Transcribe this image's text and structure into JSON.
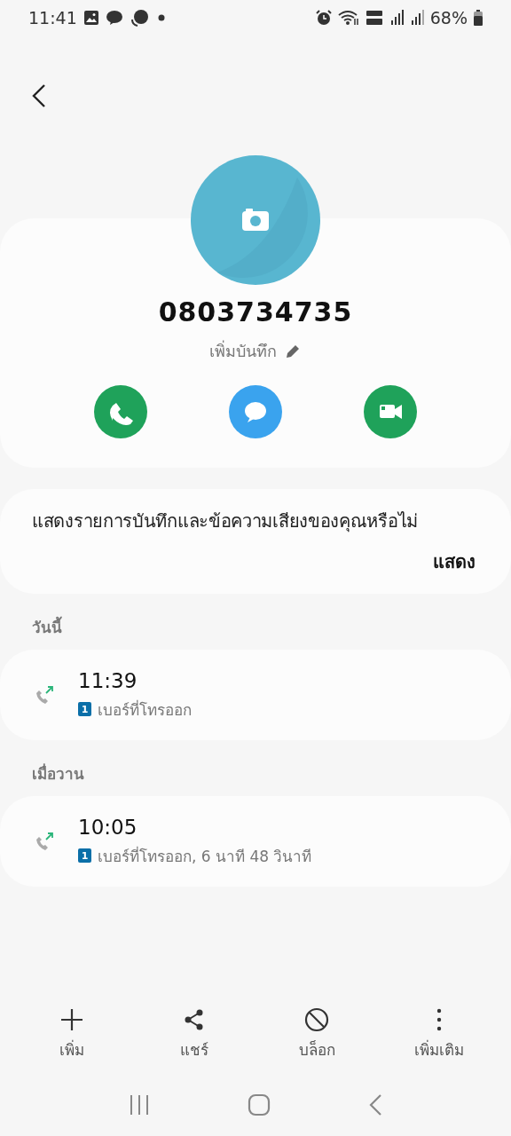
{
  "status_bar": {
    "time": "11:41",
    "battery": "68%"
  },
  "contact": {
    "number": "0803734735",
    "note_link": "เพิ่มบันทึก",
    "actions": [
      {
        "kind": "call"
      },
      {
        "kind": "message"
      },
      {
        "kind": "video"
      }
    ]
  },
  "notice": {
    "text": "แสดงรายการบันทึกและข้อความเสียงของคุณหรือไม่",
    "button": "แสดง"
  },
  "call_groups": [
    {
      "heading": "วันนี้",
      "calls": [
        {
          "kind": "outgoing",
          "time": "11:39",
          "sim": "1",
          "detail": "เบอร์ที่โทรออก"
        }
      ]
    },
    {
      "heading": "เมื่อวาน",
      "calls": [
        {
          "kind": "outgoing",
          "time": "10:05",
          "sim": "1",
          "detail": "เบอร์ที่โทรออก, 6 นาที 48 วินาที"
        }
      ]
    }
  ],
  "bottom_actions": [
    {
      "kind": "add",
      "label": "เพิ่ม"
    },
    {
      "kind": "share",
      "label": "แชร์"
    },
    {
      "kind": "block",
      "label": "บล็อก"
    },
    {
      "kind": "more",
      "label": "เพิ่มเติม"
    }
  ]
}
